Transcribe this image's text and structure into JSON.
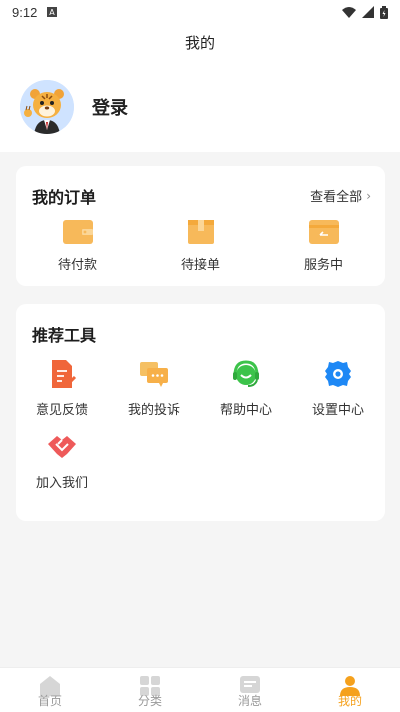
{
  "status_bar": {
    "time": "9:12"
  },
  "header": {
    "title": "我的"
  },
  "profile": {
    "login_label": "登录"
  },
  "orders": {
    "title": "我的订单",
    "view_all": "查看全部",
    "items": [
      {
        "label": "待付款",
        "icon": "wallet-icon"
      },
      {
        "label": "待接单",
        "icon": "box-icon"
      },
      {
        "label": "服务中",
        "icon": "service-card-icon"
      }
    ]
  },
  "tools": {
    "title": "推荐工具",
    "items": [
      {
        "label": "意见反馈",
        "icon": "feedback-doc-icon"
      },
      {
        "label": "我的投诉",
        "icon": "chat-complaint-icon"
      },
      {
        "label": "帮助中心",
        "icon": "headset-icon"
      },
      {
        "label": "设置中心",
        "icon": "gear-icon"
      },
      {
        "label": "加入我们",
        "icon": "handshake-icon"
      }
    ]
  },
  "tabbar": {
    "items": [
      {
        "label": "首页",
        "icon": "home-icon",
        "active": false
      },
      {
        "label": "分类",
        "icon": "grid-icon",
        "active": false
      },
      {
        "label": "消息",
        "icon": "message-icon",
        "active": false
      },
      {
        "label": "我的",
        "icon": "user-icon",
        "active": true
      }
    ]
  },
  "colors": {
    "accent": "#f5a11d",
    "order_icon": "#f7b95a",
    "feedback": "#f0663a",
    "help": "#3cc34a",
    "settings": "#1e88f5",
    "join": "#ee5a5a"
  }
}
